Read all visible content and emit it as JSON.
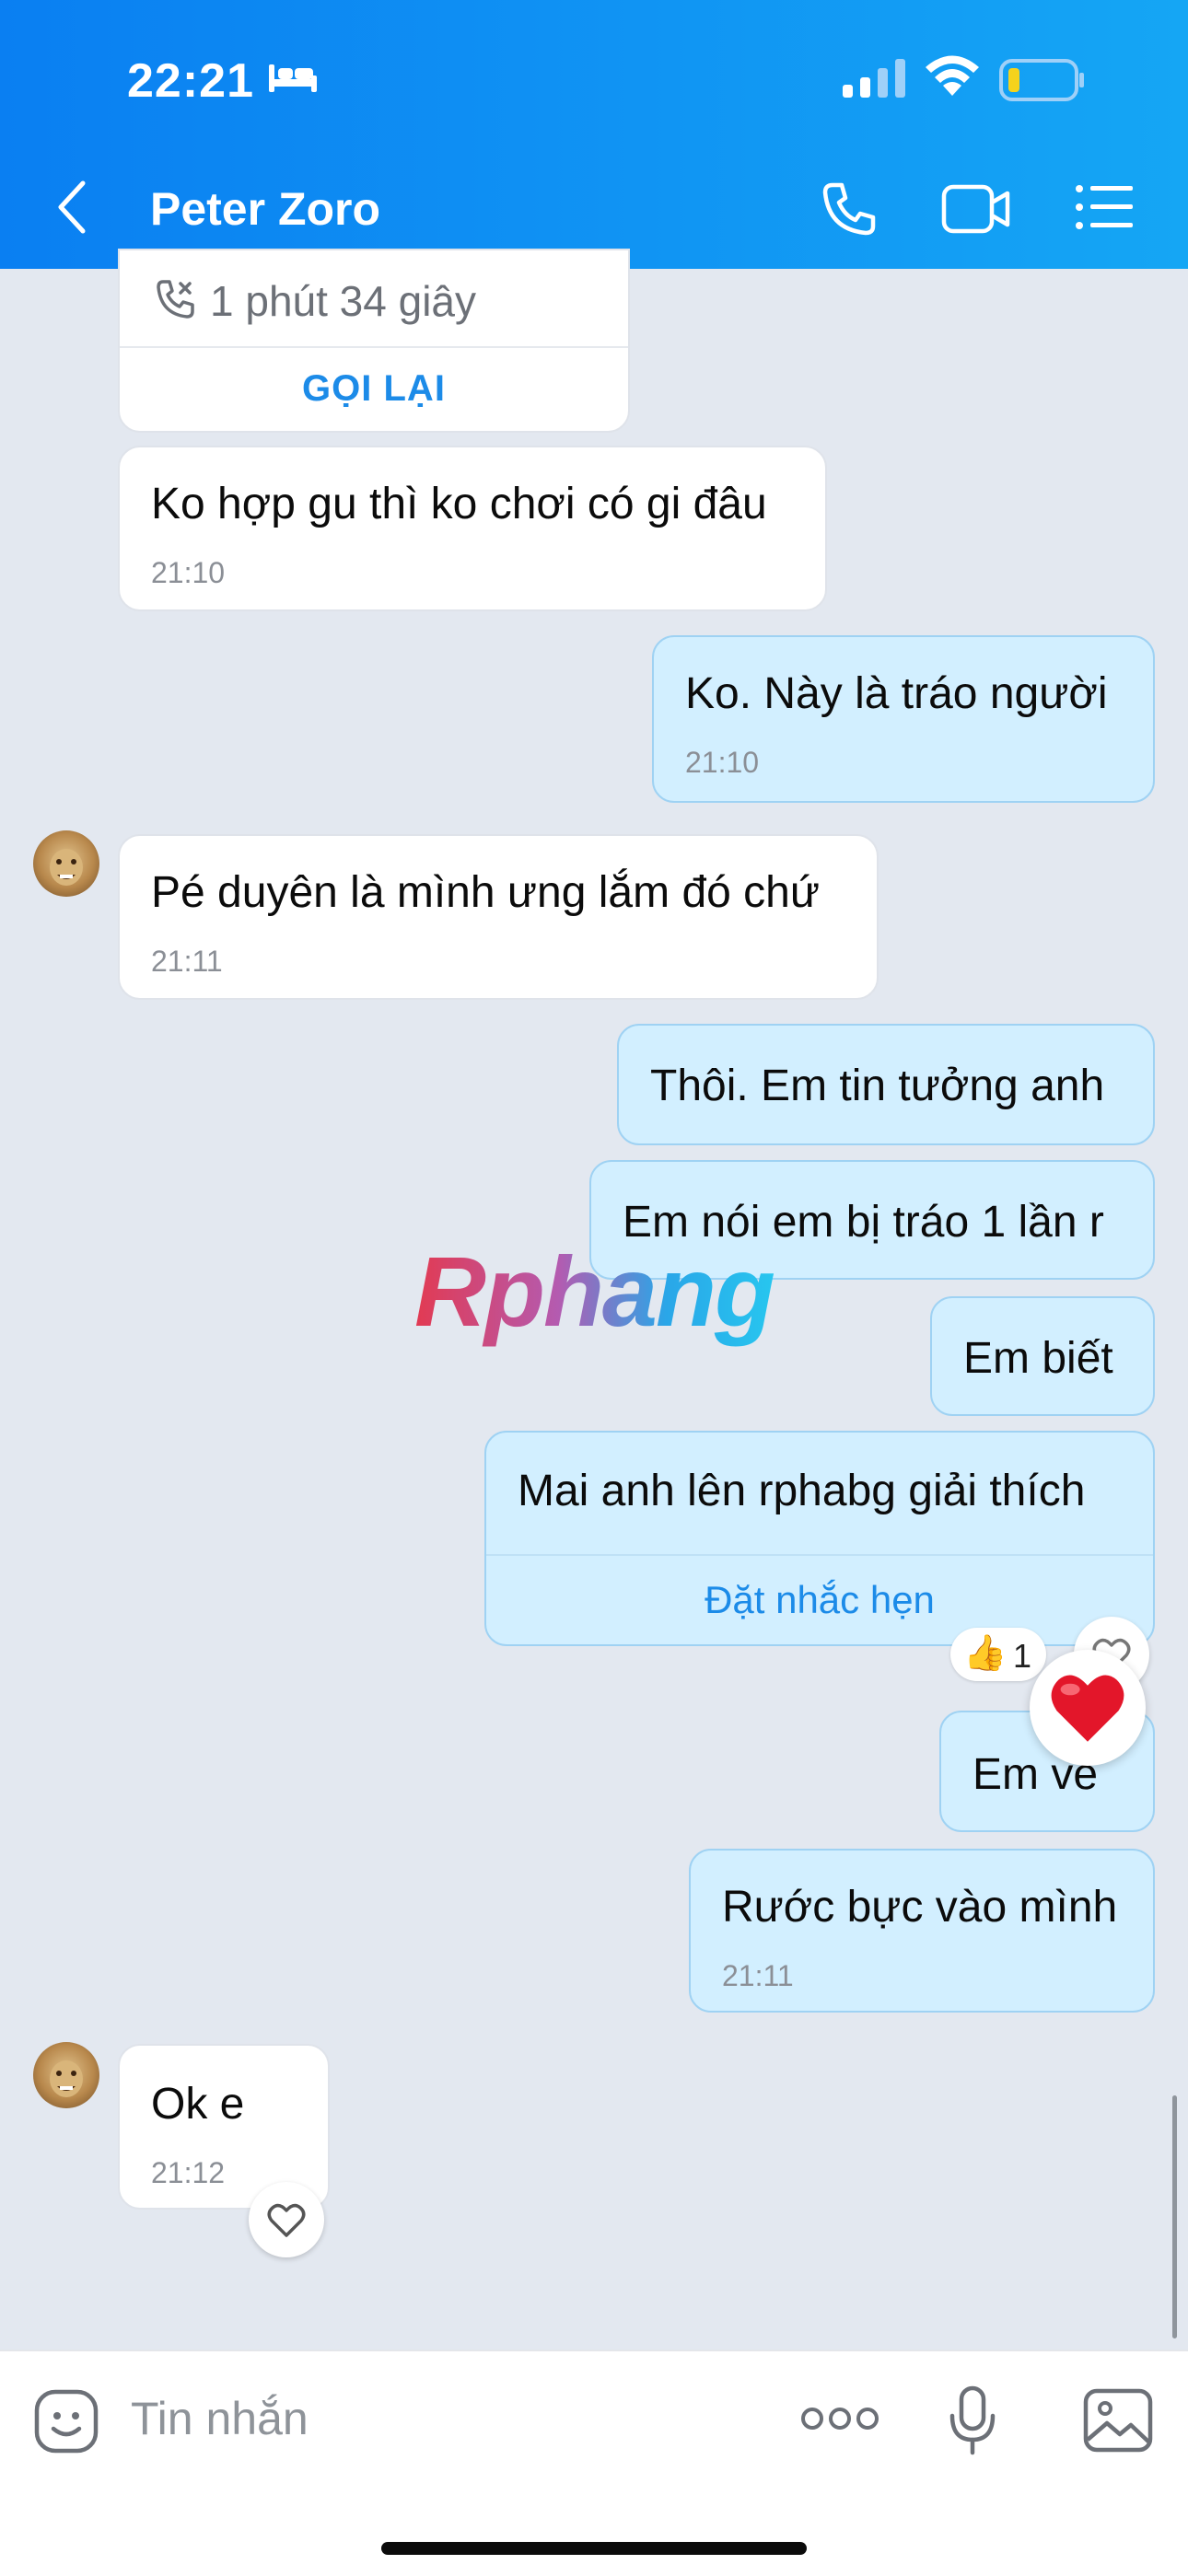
{
  "status_bar": {
    "time": "22:21"
  },
  "header": {
    "title": "Peter Zoro"
  },
  "call_card": {
    "duration": "1 phút 34 giây",
    "call_back_label": "GỌI LẠI"
  },
  "messages": [
    {
      "text": "Ko hợp gu thì ko chơi có gi đâu",
      "time": "21:10"
    },
    {
      "text": "Ko. Này là tráo người",
      "time": "21:10"
    },
    {
      "text": "Pé duyên là mình ưng lắm đó chứ",
      "time": "21:11"
    },
    {
      "text": "Thôi. Em tin tưởng anh"
    },
    {
      "text": "Em nói em bị tráo 1 lần r"
    },
    {
      "text": "Em biết"
    },
    {
      "text": "Mai anh lên rphabg giải thích",
      "action": "Đặt nhắc hẹn"
    },
    {
      "text": "Em về"
    },
    {
      "text": "Rước bực vào mình",
      "time": "21:11"
    },
    {
      "text": "Ok e",
      "time": "21:12"
    }
  ],
  "reaction": {
    "emoji": "👍",
    "count": "1"
  },
  "watermark": "Rphang",
  "composer": {
    "placeholder": "Tin nhắn"
  },
  "colors": {
    "header_start": "#0a7ff2",
    "header_end": "#15a6f4",
    "outgoing_bubble": "#d2efff",
    "link": "#1c8be8",
    "background": "#e3e8f0"
  }
}
